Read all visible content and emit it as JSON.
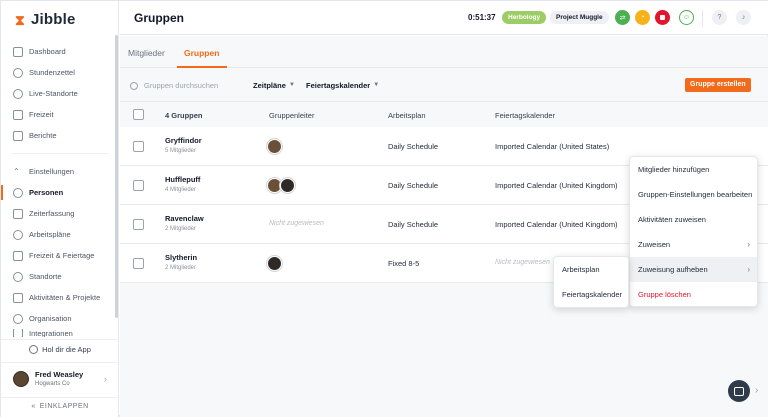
{
  "app": {
    "brand": "Jibble"
  },
  "sidebar": {
    "items_top": [
      {
        "label": "Dashboard",
        "icon": "dashboard-icon"
      },
      {
        "label": "Stundenzettel",
        "icon": "clock-icon"
      },
      {
        "label": "Live-Standorte",
        "icon": "location-icon"
      },
      {
        "label": "Freizeit",
        "icon": "suitcase-icon"
      },
      {
        "label": "Berichte",
        "icon": "report-icon"
      }
    ],
    "items_settings": [
      {
        "label": "Einstellungen",
        "icon": "chevron-up-icon"
      },
      {
        "label": "Personen",
        "icon": "people-icon"
      },
      {
        "label": "Zeiterfassung",
        "icon": "time-tracking-icon"
      },
      {
        "label": "Arbeitspläne",
        "icon": "schedule-icon"
      },
      {
        "label": "Freizeit & Feiertage",
        "icon": "calendar-icon"
      },
      {
        "label": "Standorte",
        "icon": "pin-icon"
      },
      {
        "label": "Aktivitäten & Projekte",
        "icon": "tag-icon"
      },
      {
        "label": "Organisation",
        "icon": "gear-icon"
      },
      {
        "label": "Integrationen",
        "icon": "plug-icon"
      }
    ],
    "get_app": "Hol dir die App",
    "user": {
      "name": "Fred Weasley",
      "org": "Hogwarts Co"
    },
    "collapse": "EINKLAPPEN"
  },
  "topbar": {
    "title": "Gruppen",
    "timer": "0:51:37",
    "activity": "Herbology",
    "project": "Project Muggle"
  },
  "tabs": [
    "Mitglieder",
    "Gruppen"
  ],
  "toolbar": {
    "search_placeholder": "Gruppen durchsuchen",
    "filter_schedules": "Zeitpläne",
    "filter_holidays": "Feiertagskalender",
    "create": "Gruppe erstellen"
  },
  "table": {
    "headers": [
      "4 Gruppen",
      "Gruppenleiter",
      "Arbeitsplan",
      "Feiertagskalender"
    ],
    "rows": [
      {
        "name": "Gryffindor",
        "members": "5 Mitglieder",
        "schedule": "Daily Schedule",
        "calendar": "Imported Calendar (United States)"
      },
      {
        "name": "Hufflepuff",
        "members": "4 Mitglieder",
        "schedule": "Daily Schedule",
        "calendar": "Imported Calendar (United Kingdom)"
      },
      {
        "name": "Ravenclaw",
        "members": "2 Mitglieder",
        "leader": "Nicht zugewiesen",
        "schedule": "Daily Schedule",
        "calendar": "Imported Calendar (United Kingdom)"
      },
      {
        "name": "Slytherin",
        "members": "2 Mitglieder",
        "schedule": "Fixed 8-5",
        "calendar": "Nicht zugewiesen"
      }
    ]
  },
  "context_menu": {
    "items": [
      "Mitglieder hinzufügen",
      "Gruppen-Einstellungen bearbeiten",
      "Aktivitäten zuweisen",
      "Zuweisen",
      "Zuweisung aufheben",
      "Gruppe löschen"
    ],
    "submenu": [
      "Arbeitsplan",
      "Feiertagskalender"
    ]
  }
}
